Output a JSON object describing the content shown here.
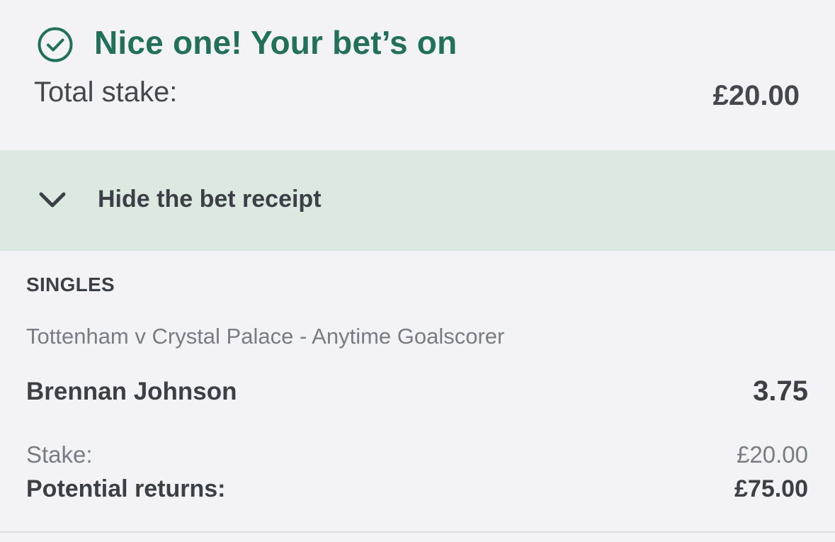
{
  "confirmation": {
    "icon": "check-circle-icon",
    "title": "Nice one! Your bet’s on",
    "total_stake_label": "Total stake:",
    "total_stake_value": "£20.00",
    "accent_color": "#23705a"
  },
  "toggle": {
    "icon": "chevron-down-icon",
    "label": "Hide the bet receipt",
    "background_color": "#dce9e1"
  },
  "receipt": {
    "section_label": "SINGLES",
    "market": "Tottenham v Crystal Palace - Anytime Goalscorer",
    "selection": "Brennan Johnson",
    "odds": "3.75",
    "stake_label": "Stake:",
    "stake_value": "£20.00",
    "returns_label": "Potential returns:",
    "returns_value": "£75.00"
  }
}
